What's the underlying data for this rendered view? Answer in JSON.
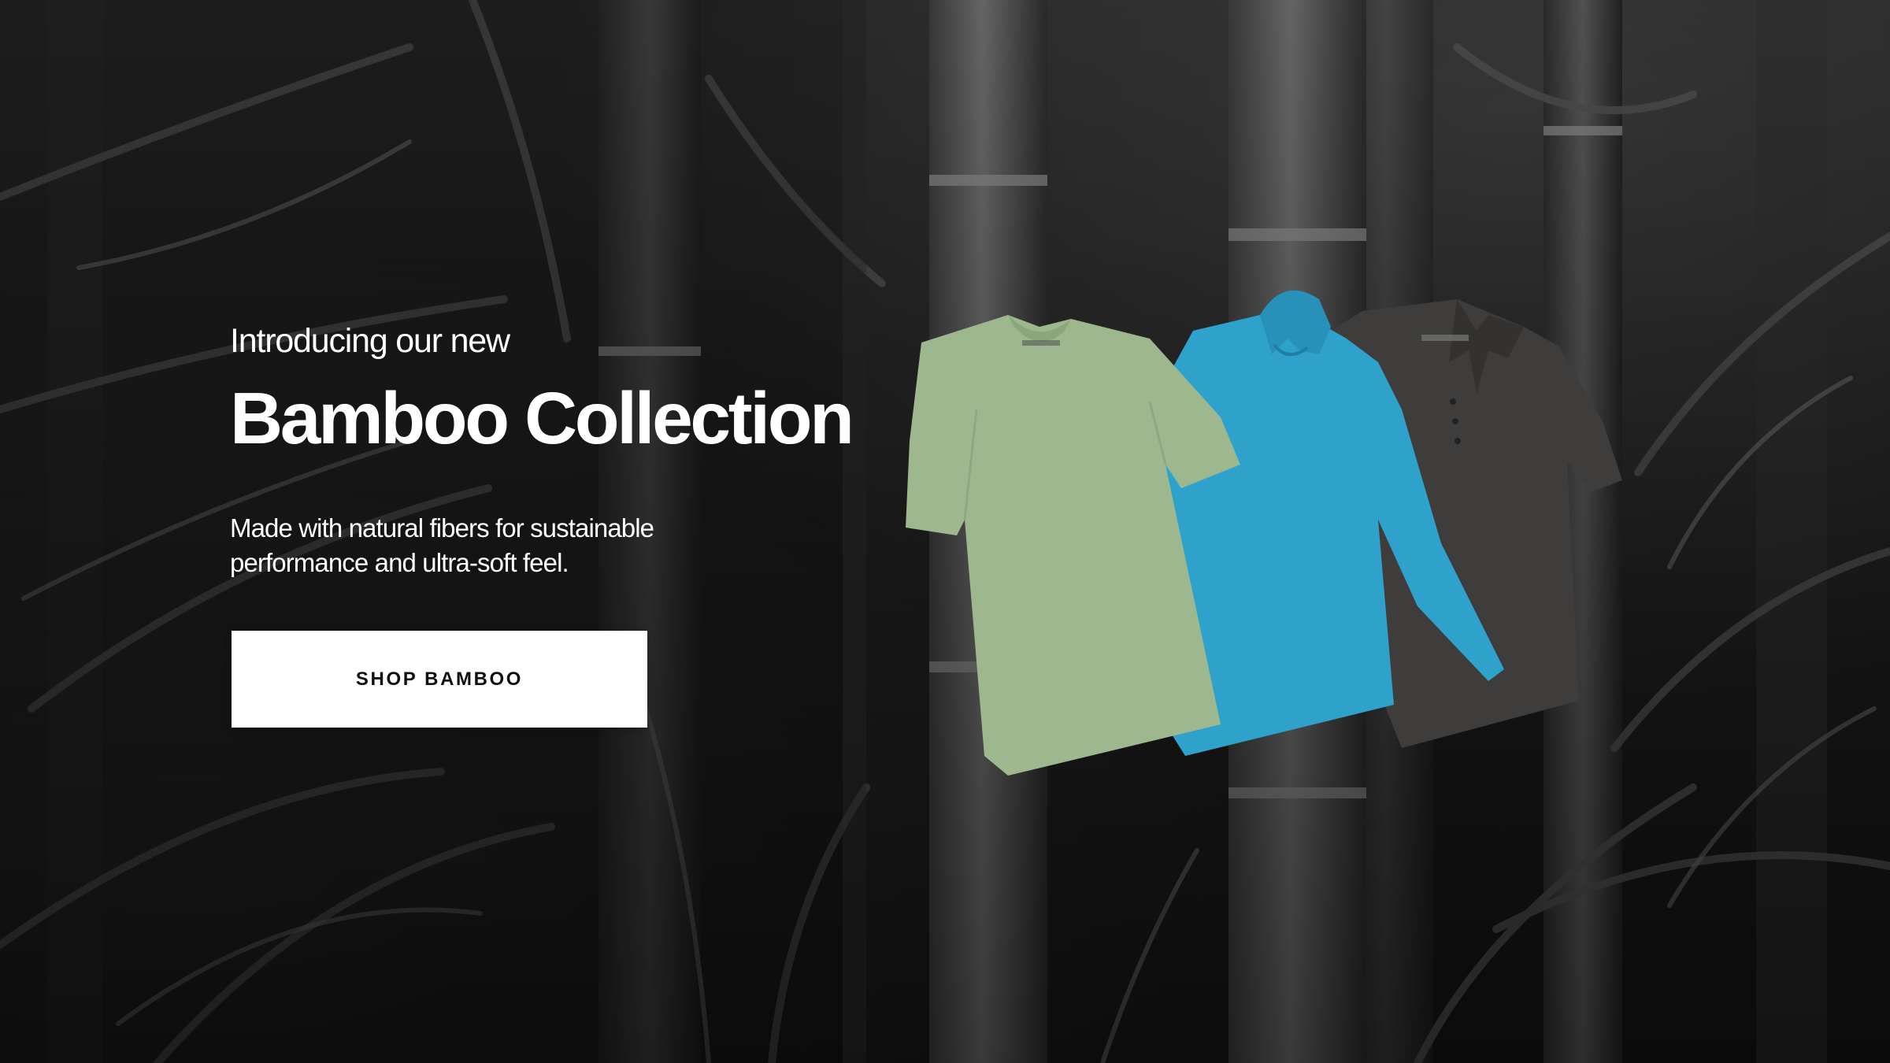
{
  "hero": {
    "eyebrow": "Introducing our new",
    "headline": "Bamboo Collection",
    "description_line1": "Made with natural fibers for sustainable",
    "description_line2": "performance and ultra-soft feel.",
    "cta_label": "SHOP BAMBOO"
  },
  "products": [
    {
      "name": "sage-green-tee",
      "color": "#9DB88F"
    },
    {
      "name": "turquoise-hoodie",
      "color": "#2FA2CC"
    },
    {
      "name": "charcoal-polo",
      "color": "#3F3D3B"
    }
  ],
  "colors": {
    "background": "#1E1E1E",
    "cta_background": "#FFFFFF",
    "cta_text": "#111111",
    "text": "#FFFFFF"
  }
}
